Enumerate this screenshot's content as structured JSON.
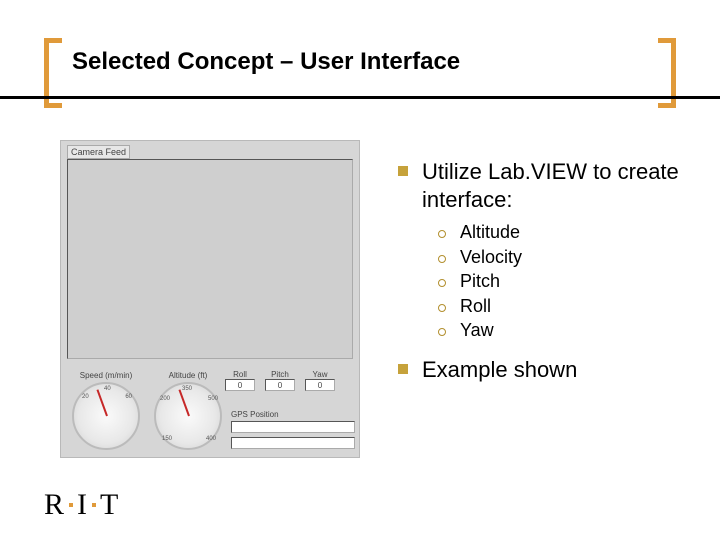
{
  "title": "Selected Concept – User Interface",
  "panel": {
    "camera_label": "Camera Feed",
    "gauge1_label": "Speed (m/min)",
    "gauge2_label": "Altitude (ft)",
    "gauge1_ticks": {
      "a": "20",
      "b": "40",
      "c": "60"
    },
    "gauge2_ticks": {
      "a": "200",
      "b": "350",
      "c": "500",
      "d": "150",
      "e": "400"
    },
    "roll": {
      "label": "Roll",
      "value": "0"
    },
    "pitch": {
      "label": "Pitch",
      "value": "0"
    },
    "yaw": {
      "label": "Yaw",
      "value": "0"
    },
    "gps_label": "GPS Position"
  },
  "bullets": {
    "main1": "Utilize Lab.VIEW to create interface:",
    "subs": {
      "s0": "Altitude",
      "s1": "Velocity",
      "s2": "Pitch",
      "s3": "Roll",
      "s4": "Yaw"
    },
    "main2": "Example shown"
  },
  "logo": {
    "r": "R",
    "i": "I",
    "t": "T"
  }
}
